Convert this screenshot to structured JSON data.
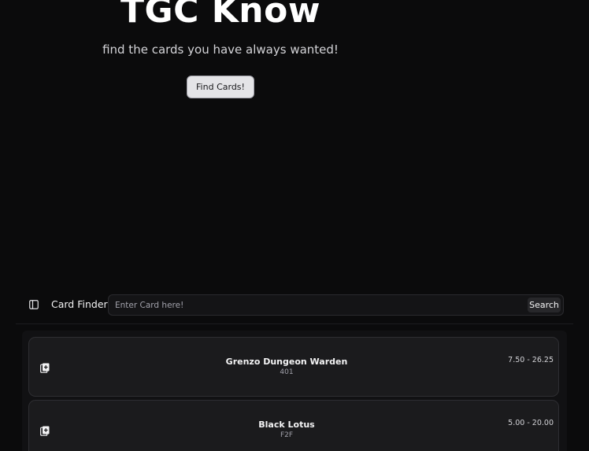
{
  "hero": {
    "title": "TGC Know",
    "subtitle": "find the cards you have always wanted!",
    "button_label": "Find Cards!"
  },
  "toolbar": {
    "title": "Card Finder",
    "search_placeholder": "Enter Card here!",
    "search_value": "",
    "search_button_label": "Search"
  },
  "cards": [
    {
      "name": "Grenzo Dungeon Warden",
      "set": "401",
      "price_range": "7.50 - 26.25",
      "icon": "cards-icon"
    },
    {
      "name": "Black Lotus",
      "set": "F2F",
      "price_range": "5.00 - 20.00",
      "icon": "cards-icon"
    }
  ],
  "colors": {
    "background": "#0b0b0c",
    "card_background": "#1b1b1d",
    "card_border": "#2e2e32",
    "button_background": "#e4e4e7"
  }
}
